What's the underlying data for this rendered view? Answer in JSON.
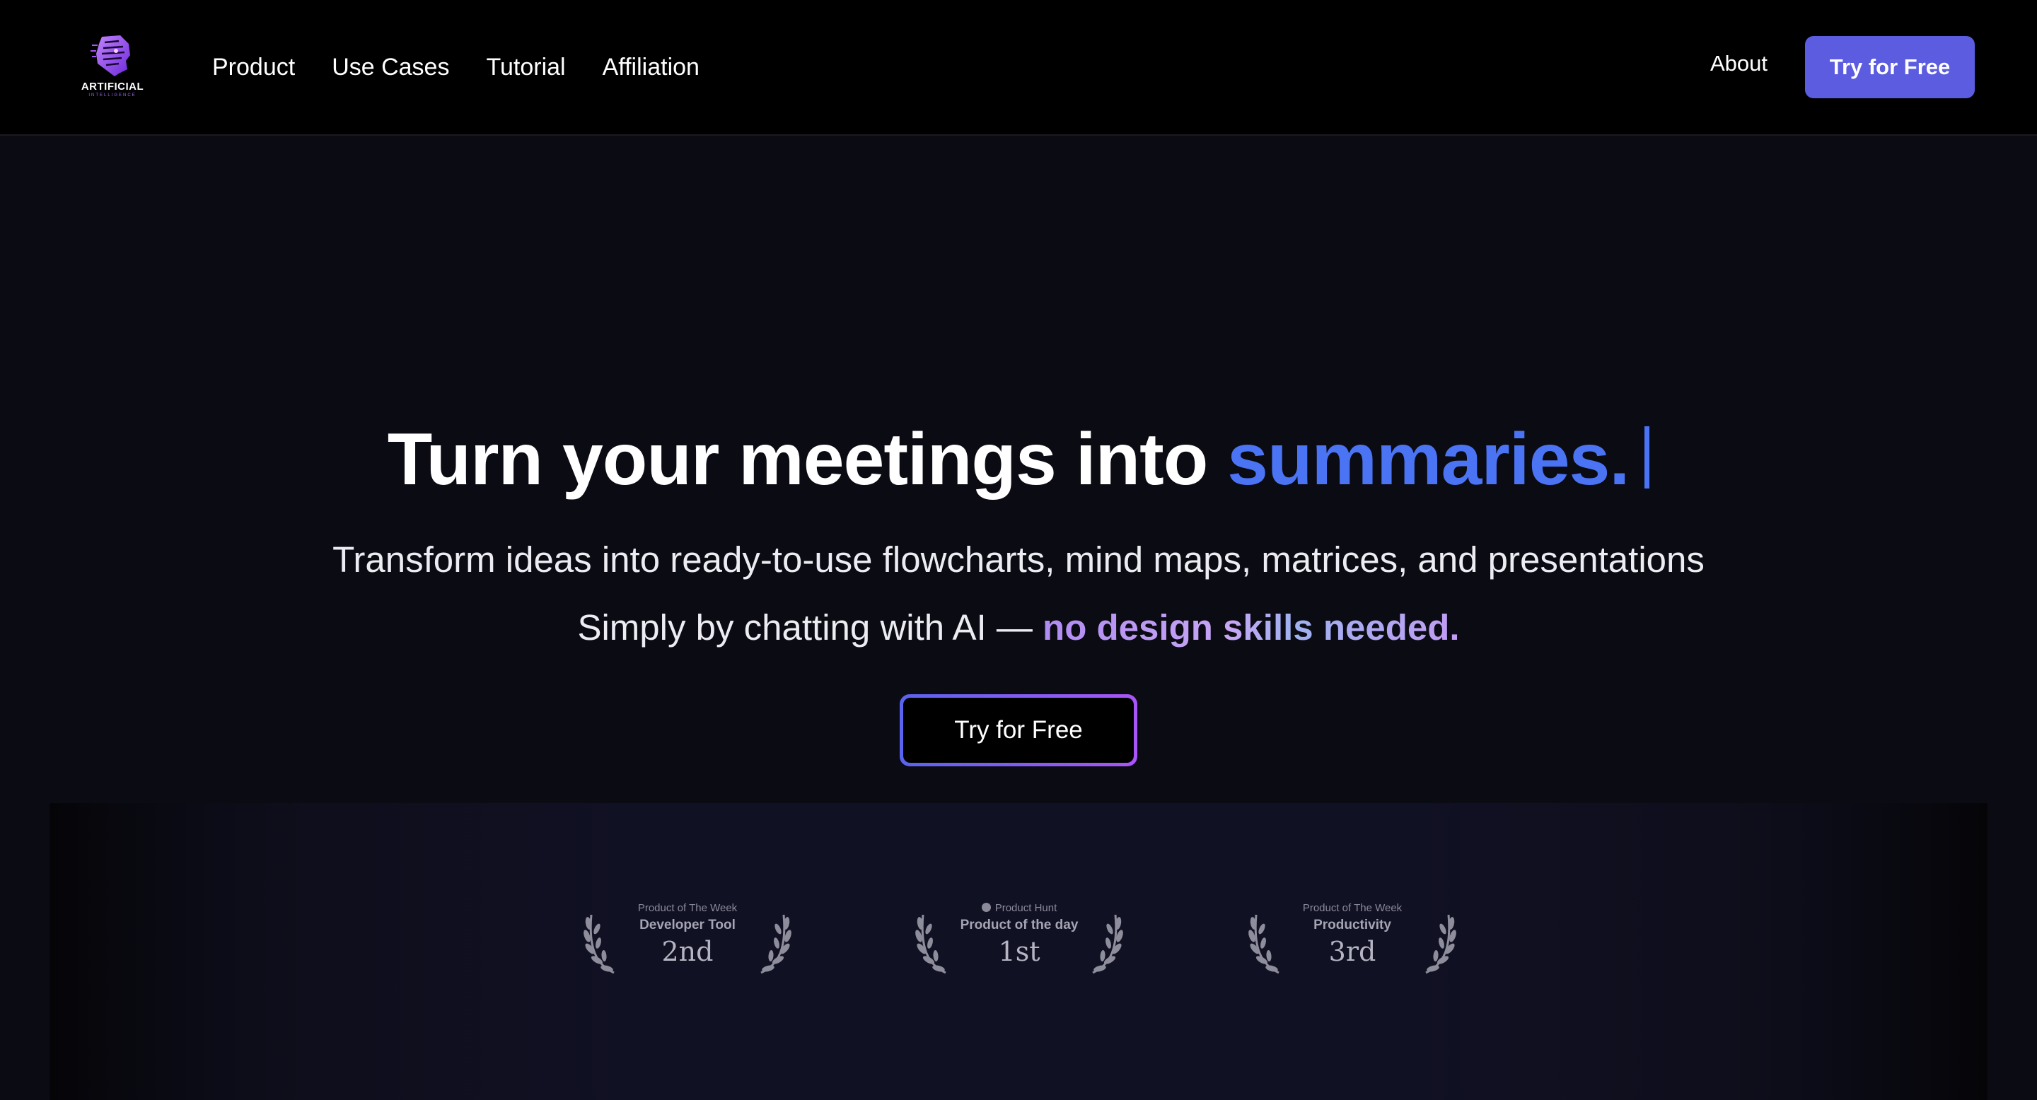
{
  "brand": {
    "name": "ARTIFICIAL",
    "tagline": "INTELLIGENCE"
  },
  "nav": {
    "links": [
      "Product",
      "Use Cases",
      "Tutorial",
      "Affiliation"
    ],
    "about": "About",
    "cta": "Try for Free"
  },
  "hero": {
    "title_plain": "Turn your meetings into ",
    "title_accent": "summaries.",
    "subtitle1": "Transform ideas into ready-to-use flowcharts, mind maps, matrices, and presentations",
    "subtitle2_plain": "Simply by chatting with AI — ",
    "subtitle2_highlight": "no design skills needed.",
    "cta": "Try for Free"
  },
  "awards": [
    {
      "top": "Product of The Week",
      "label": "Developer Tool",
      "rank": "2nd"
    },
    {
      "top": "Product Hunt",
      "label": "Product of the day",
      "rank": "1st"
    },
    {
      "top": "Product of The Week",
      "label": "Productivity",
      "rank": "3rd"
    }
  ],
  "colors": {
    "accent_blue": "#4b74f5",
    "nav_cta_bg": "#5b5ce0",
    "gradient_start": "#5a63ee",
    "gradient_end": "#a855f7"
  }
}
